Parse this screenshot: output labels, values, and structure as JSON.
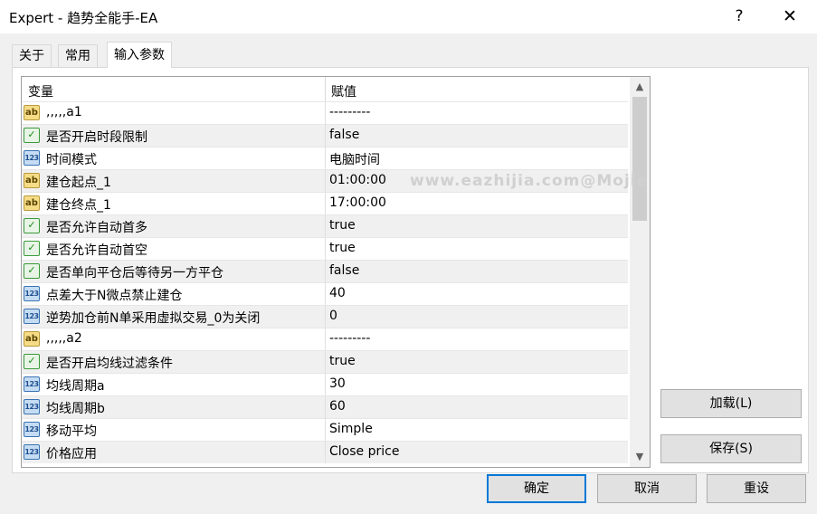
{
  "window": {
    "title": "Expert - 趋势全能手-EA",
    "help_symbol": "?",
    "close_symbol": "✕"
  },
  "tabs": [
    {
      "label": "关于"
    },
    {
      "label": "常用"
    },
    {
      "label": "输入参数",
      "active": true
    }
  ],
  "grid": {
    "columns": [
      "变量",
      "赋值"
    ],
    "rows": [
      {
        "type": "ab",
        "name": ",,,,,a1",
        "value": "---------"
      },
      {
        "type": "bool",
        "name": "是否开启时段限制",
        "value": "false"
      },
      {
        "type": "num",
        "name": "时间模式",
        "value": "电脑时间"
      },
      {
        "type": "ab",
        "name": "建仓起点_1",
        "value": "01:00:00"
      },
      {
        "type": "ab",
        "name": "建仓终点_1",
        "value": "17:00:00"
      },
      {
        "type": "bool",
        "name": "是否允许自动首多",
        "value": "true"
      },
      {
        "type": "bool",
        "name": "是否允许自动首空",
        "value": "true"
      },
      {
        "type": "bool",
        "name": "是否单向平仓后等待另一方平仓",
        "value": "false"
      },
      {
        "type": "num",
        "name": "点差大于N微点禁止建仓",
        "value": "40"
      },
      {
        "type": "num",
        "name": "逆势加仓前N单采用虚拟交易_0为关闭",
        "value": "0"
      },
      {
        "type": "ab",
        "name": ",,,,,a2",
        "value": "---------"
      },
      {
        "type": "bool",
        "name": "是否开启均线过滤条件",
        "value": "true"
      },
      {
        "type": "num",
        "name": "均线周期a",
        "value": "30"
      },
      {
        "type": "num",
        "name": "均线周期b",
        "value": "60"
      },
      {
        "type": "num",
        "name": "移动平均",
        "value": "Simple"
      },
      {
        "type": "num",
        "name": "价格应用",
        "value": "Close price"
      }
    ]
  },
  "icons": {
    "ab": "ab",
    "bool": "✓",
    "num": "123"
  },
  "watermark": "www.eazhijia.com@Mojie",
  "buttons": {
    "load": "加载(L)",
    "save": "保存(S)",
    "ok": "确定",
    "cancel": "取消",
    "reset": "重设"
  },
  "colors": {
    "accent": "#0078d7",
    "alt_row": "#f0f0f0"
  }
}
